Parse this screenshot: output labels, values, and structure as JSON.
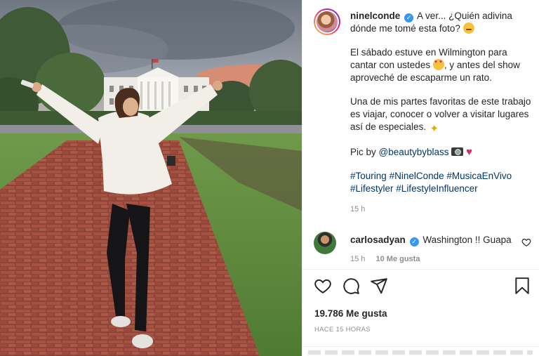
{
  "post": {
    "username": "ninelconde",
    "verified": true,
    "caption_line1": "A ver... ¿Quién adivina dónde me tomé esta foto?",
    "caption_p2_a": "El sábado estuve en Wilmington para cantar con ustedes",
    "caption_p2_b": ", y antes del show aproveché de escaparme un rato.",
    "caption_p3": "Una de mis partes favoritas de este trabajo es viajar, conocer o volver a visitar lugares así de especiales.",
    "pic_by_label": "Pic by",
    "pic_by_mention": "@beautybyblass",
    "hashtags": [
      "#Touring",
      "#NinelConde",
      "#MusicaEnVivo",
      "#Lifestyler",
      "#LifestyleInfluencer"
    ],
    "timestamp": "15 h",
    "icons": {
      "emoji_1": "grimacing-face-emoji",
      "emoji_2": "smiling-face-with-hearts-emoji",
      "emoji_3": "sparkles-emoji",
      "emoji_4": "camera-emoji",
      "emoji_5": "red-heart-emoji"
    }
  },
  "comment": {
    "username": "carlosadyan",
    "verified": true,
    "text": "Washington !! Guapa",
    "time": "15 h",
    "likes": "10 Me gusta"
  },
  "actions": {
    "like": "heart-icon",
    "comment": "comment-icon",
    "share": "paper-plane-icon",
    "save": "bookmark-icon"
  },
  "likes_count": "19.786 Me gusta",
  "posted_ago": "HACE 15 HORAS",
  "colors": {
    "accent_blue": "#3897f0",
    "link_blue": "#00376b",
    "muted_gray": "#8e8e8e",
    "text_dark": "#262626"
  }
}
